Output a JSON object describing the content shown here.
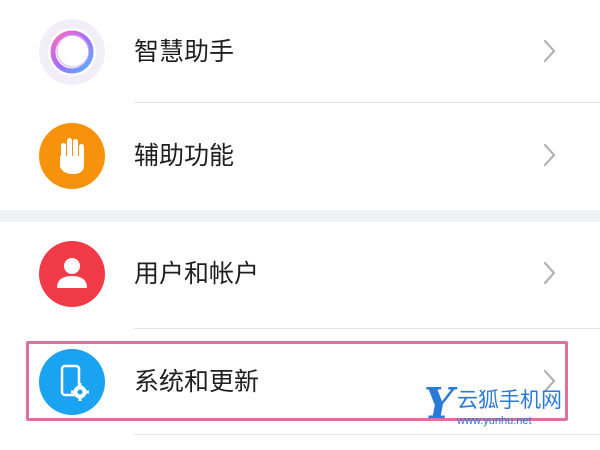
{
  "settings": {
    "items": [
      {
        "label": "智慧助手",
        "icon": "smart-assistant-icon",
        "color": "#b06cf0"
      },
      {
        "label": "辅助功能",
        "icon": "hand-icon",
        "color": "#f7920d"
      },
      {
        "label": "用户和帐户",
        "icon": "user-icon",
        "color": "#f03a47"
      },
      {
        "label": "系统和更新",
        "icon": "system-update-icon",
        "color": "#1aa3f0"
      }
    ],
    "chevron_icon": "chevron-right-icon"
  },
  "highlight": {
    "color": "#e0709e"
  },
  "watermark": {
    "logo_letter": "Y",
    "name": "云狐手机网",
    "url": "www.yunhu.net"
  }
}
